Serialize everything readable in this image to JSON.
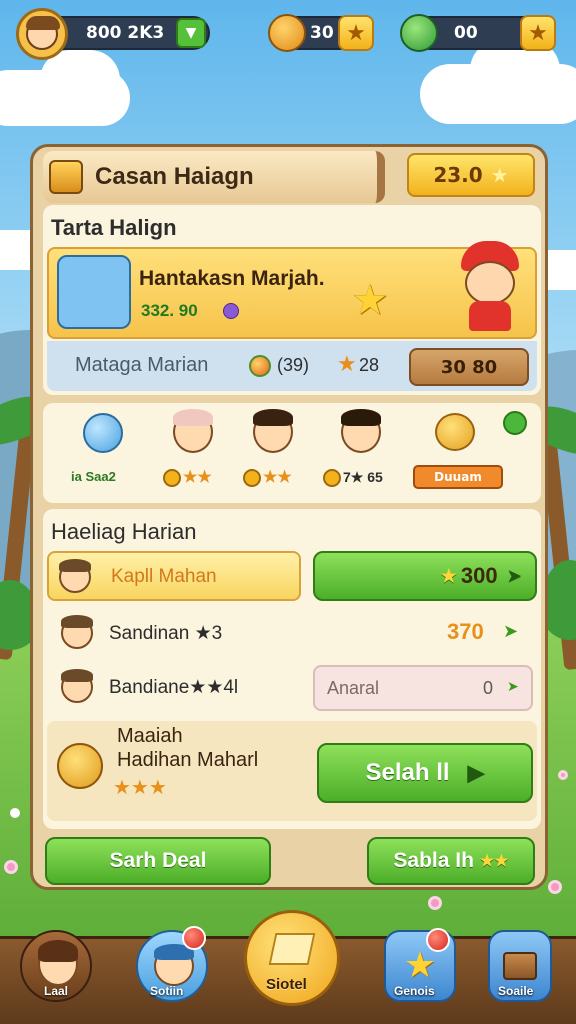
{
  "top_bar": {
    "coins": "800 2K3",
    "item_one": "30",
    "item_two": "00"
  },
  "panel": {
    "title": "Casan Haiagn",
    "title_badge": "23.0",
    "section_one": {
      "heading": "Tarta Halign",
      "banner_title": "Hantakasn Marjah.",
      "banner_value": "332. 90",
      "row_label": "Mataga Marian",
      "row_count": "(39)",
      "row_stars": "28",
      "row_button": "30 80"
    },
    "characters": [
      {
        "label": "ia Saa2"
      },
      {
        "label": "★★"
      },
      {
        "label": "★★"
      },
      {
        "label": "7★ 65"
      },
      {
        "label": "Duuam"
      }
    ],
    "section_two": {
      "heading": "Haeliag Harian",
      "rows": [
        {
          "name": "Kapll Mahan",
          "value": "300"
        },
        {
          "name": "Sandinan ★3",
          "value": "370"
        },
        {
          "name": "Bandiane★★4l",
          "field": "Anaral",
          "value": "0"
        }
      ]
    },
    "reward": {
      "line1": "Maaiah",
      "line2": "Hadihan Maharl",
      "button": "Selah  ll"
    },
    "footer_buttons": {
      "left": "Sarh Deal",
      "right": "Sabla Ih"
    }
  },
  "bottom_nav": [
    {
      "label": "Laal"
    },
    {
      "label": "Sotiin"
    },
    {
      "label": "Siotel"
    },
    {
      "label": "Genois"
    },
    {
      "label": "Soaile"
    }
  ]
}
